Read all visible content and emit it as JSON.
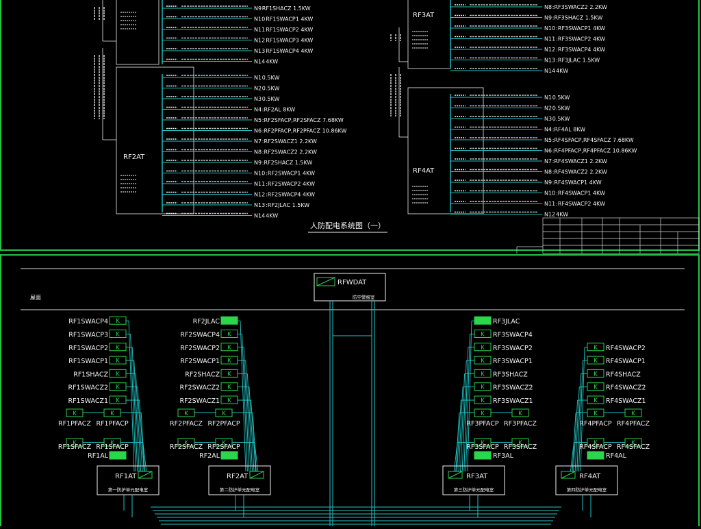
{
  "colors": {
    "background": "#000000",
    "frame_green": "#22c744",
    "wire_cyan": "#22c7c7",
    "text_white": "#f2f2f2",
    "switch_green": "#2ad64a",
    "panel_white": "#e0e0e0",
    "watermark": "#5a5a5a"
  },
  "top": {
    "title": "人防配电系统图（一）",
    "left": {
      "panel_first": {
        "circuits": [
          {
            "num": "N9",
            "label": "RF1SHACZ 1.5KW"
          },
          {
            "num": "N10",
            "label": "RF1SWACP1 4KW"
          },
          {
            "num": "N11",
            "label": "RF1SWACP2 4KW"
          },
          {
            "num": "N12",
            "label": "RF1SWACP3 4KW"
          },
          {
            "num": "N13",
            "label": "RF1SWACP4 4KW"
          },
          {
            "num": "N14",
            "label": "4KW"
          }
        ]
      },
      "panel_second": {
        "name": "RF2AT",
        "circuits": [
          {
            "num": "N1",
            "label": "0.5KW"
          },
          {
            "num": "N2",
            "label": "0.5KW"
          },
          {
            "num": "N3",
            "label": "0.5KW"
          },
          {
            "num": "N4",
            "label": ":RF2AL 8KW"
          },
          {
            "num": "N5",
            "label": ":RF2SFACP,RF2SFACZ 7.68KW"
          },
          {
            "num": "N6",
            "label": ":RF2PFACP,RF2PFACZ 10.86KW"
          },
          {
            "num": "N7",
            "label": ":RF2SWACZ1 2.2KW"
          },
          {
            "num": "N8",
            "label": ":RF2SWACZ2 2.2KW"
          },
          {
            "num": "N9",
            "label": ":RF2SHACZ 1.5KW"
          },
          {
            "num": "N10",
            "label": ":RF2SWACP1 4KW"
          },
          {
            "num": "N11",
            "label": ":RF2SWACP2 4KW"
          },
          {
            "num": "N12",
            "label": ":RF2SWACP4 4KW"
          },
          {
            "num": "N13",
            "label": ":RF2JLAC 1.5KW"
          },
          {
            "num": "N14",
            "label": "4KW"
          }
        ]
      }
    },
    "right": {
      "panel_first": {
        "name": "RF3AT",
        "circuits": [
          {
            "num": "N8",
            "label": ":RF3SWACZ2 2.2KW"
          },
          {
            "num": "N9",
            "label": ":RF3SHACZ 1.5KW"
          },
          {
            "num": "N10",
            "label": ":RF3SWACP1 4KW"
          },
          {
            "num": "N11",
            "label": ":RF3SWACP2 4KW"
          },
          {
            "num": "N12",
            "label": ":RF3SWACP4 4KW"
          },
          {
            "num": "N13",
            "label": ":RF3JLAC 1.5KW"
          },
          {
            "num": "N14",
            "label": "4KW"
          }
        ]
      },
      "panel_second": {
        "name": "RF4AT",
        "circuits": [
          {
            "num": "N1",
            "label": "0.5KW"
          },
          {
            "num": "N2",
            "label": "0.5KW"
          },
          {
            "num": "N3",
            "label": "0.5KW"
          },
          {
            "num": "N4",
            "label": ":RF4AL 8KW"
          },
          {
            "num": "N5",
            "label": ":RF4SFACP,RF4SFACZ 7.68KW"
          },
          {
            "num": "N6",
            "label": ":RF4PFACP,RF4PFACZ 10.86KW"
          },
          {
            "num": "N7",
            "label": ":RF4SWACZ1 2.2KW"
          },
          {
            "num": "N8",
            "label": ":RF4SWACZ2 2.2KW"
          },
          {
            "num": "N9",
            "label": ":RF4SWACP1 4KW"
          },
          {
            "num": "N10",
            "label": ":RF4SWACP1 4KW"
          },
          {
            "num": "N11",
            "label": ":RF4SWACP2 4KW"
          },
          {
            "num": "N12",
            "label": "4KW"
          }
        ]
      }
    }
  },
  "bottom": {
    "roof_label": "屋面",
    "main_panel": {
      "name": "RFWDAT",
      "caption": "防空警报室"
    },
    "switch_label": "K",
    "groups": [
      {
        "panel": "RF1AT",
        "caption": "第一防护单元配电室",
        "feeds": [
          "RF1SWACP4",
          "RF1SWACP3",
          "RF1SWACP2",
          "RF1SWACP1",
          "RF1SHACZ",
          "RF1SWACZ2",
          "RF1SWACZ1"
        ],
        "pairs": [
          [
            "RF1PFACZ",
            "RF1PFACP"
          ],
          [
            "RF1SFACZ",
            "RF1SFACP"
          ]
        ],
        "al": "RF1AL"
      },
      {
        "panel": "RF2AT",
        "caption": "第二防护单元配电室",
        "top_light": "RF2JLAC",
        "feeds": [
          "RF2SWACP4",
          "RF2SWACP2",
          "RF2SWACP1",
          "RF2SHACZ",
          "RF2SWACZ2",
          "RF2SWACZ1"
        ],
        "pairs": [
          [
            "RF2PFACZ",
            "RF2PFACP"
          ],
          [
            "RF2SFACZ",
            "RF2SFACP"
          ]
        ],
        "al": "RF2AL"
      },
      {
        "panel": "RF3AT",
        "caption": "第三防护单元配电室",
        "top_light": "RF3JLAC",
        "feeds": [
          "RF3SWACP4",
          "RF3SWACP2",
          "RF3SWACP1",
          "RF3SHACZ",
          "RF3SWACZ2",
          "RF3SWACZ1"
        ],
        "pairs": [
          [
            "RF3PFACP",
            "RF3PFACZ"
          ],
          [
            "RF3SFACP",
            "RF3SFACZ"
          ]
        ],
        "al": "RF3AL"
      },
      {
        "panel": "RF4AT",
        "caption": "第四防护单元配电室",
        "feeds": [
          "RF4SWACP2",
          "RF4SWACP1",
          "RF4SHACZ",
          "RF4SWACZ2",
          "RF4SWACZ1"
        ],
        "pairs": [
          [
            "RF4PFACP",
            "RF4PFACZ"
          ],
          [
            "RF4SFACP",
            "RF4SFACZ"
          ]
        ],
        "al": "RF4AL"
      }
    ]
  }
}
